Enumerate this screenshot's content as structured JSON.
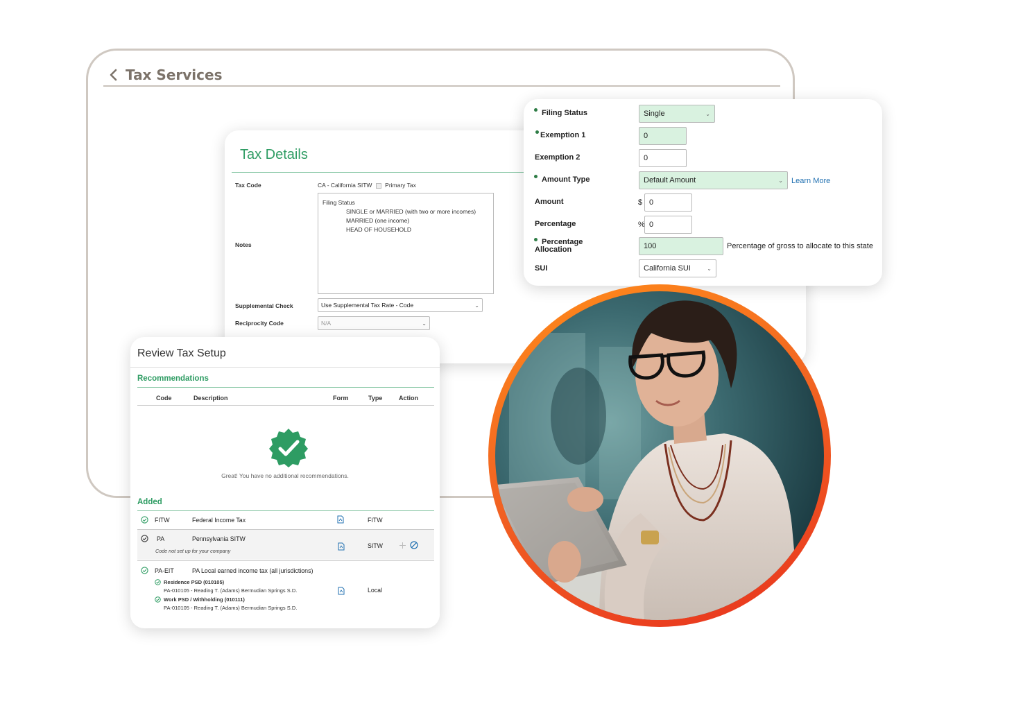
{
  "tax_services": {
    "title": "Tax Services"
  },
  "tax_details": {
    "title": "Tax Details",
    "tax_code_label": "Tax Code",
    "tax_code_value": "CA - California SITW",
    "primary_tax_label": "Primary Tax",
    "notes_label": "Notes",
    "notes_lines": [
      "Filing Status",
      "SINGLE or MARRIED (with two or more incomes)",
      "MARRIED (one income)",
      "HEAD OF HOUSEHOLD"
    ],
    "supplemental_label": "Supplemental Check",
    "supplemental_value": "Use Supplemental Tax Rate - Code",
    "reciprocity_label": "Reciprocity Code",
    "reciprocity_value": "N/A"
  },
  "filing": {
    "filing_status_label": "Filing Status",
    "filing_status_value": "Single",
    "exemption1_label": "Exemption 1",
    "exemption1_value": "0",
    "exemption2_label": "Exemption 2",
    "exemption2_value": "0",
    "amount_type_label": "Amount Type",
    "amount_type_value": "Default Amount",
    "learn_more": "Learn More",
    "amount_label": "Amount",
    "amount_prefix": "$",
    "amount_value": "0",
    "percentage_label": "Percentage",
    "percentage_prefix": "%",
    "percentage_value": "0",
    "percentage_allocation_label_1": "Percentage",
    "percentage_allocation_label_2": "Allocation",
    "percentage_allocation_value": "100",
    "percentage_allocation_hint": "Percentage of gross to allocate to this state",
    "sui_label": "SUI",
    "sui_value": "California SUI"
  },
  "review": {
    "title": "Review Tax Setup",
    "recommendations_heading": "Recommendations",
    "columns": [
      "Code",
      "Description",
      "Form",
      "Type",
      "Action"
    ],
    "empty_message": "Great! You have no additional recommendations.",
    "added_heading": "Added",
    "rows": [
      {
        "code": "FITW",
        "description": "Federal Income Tax",
        "type": "FITW"
      },
      {
        "code": "PA",
        "description": "Pennsylvania SITW",
        "note": "Code not set up for your company",
        "type": "SITW"
      },
      {
        "code": "PA-EIT",
        "description": "PA Local earned income tax (all jurisdictions)",
        "type": "Local",
        "sub": [
          {
            "title": "Residence PSD (010105)",
            "detail": "PA-010105 - Reading T. (Adams) Bermudian Springs S.D."
          },
          {
            "title": "Work PSD / Withholding (010111)",
            "detail": "PA-010105 - Reading T. (Adams) Bermudian Springs S.D."
          }
        ]
      }
    ]
  },
  "colors": {
    "brand_green": "#2e9c63",
    "field_green": "#d9f2e0",
    "link_blue": "#1f6fb0",
    "ring_orange": "#f26522",
    "frame_gray": "#cfc8c1"
  }
}
